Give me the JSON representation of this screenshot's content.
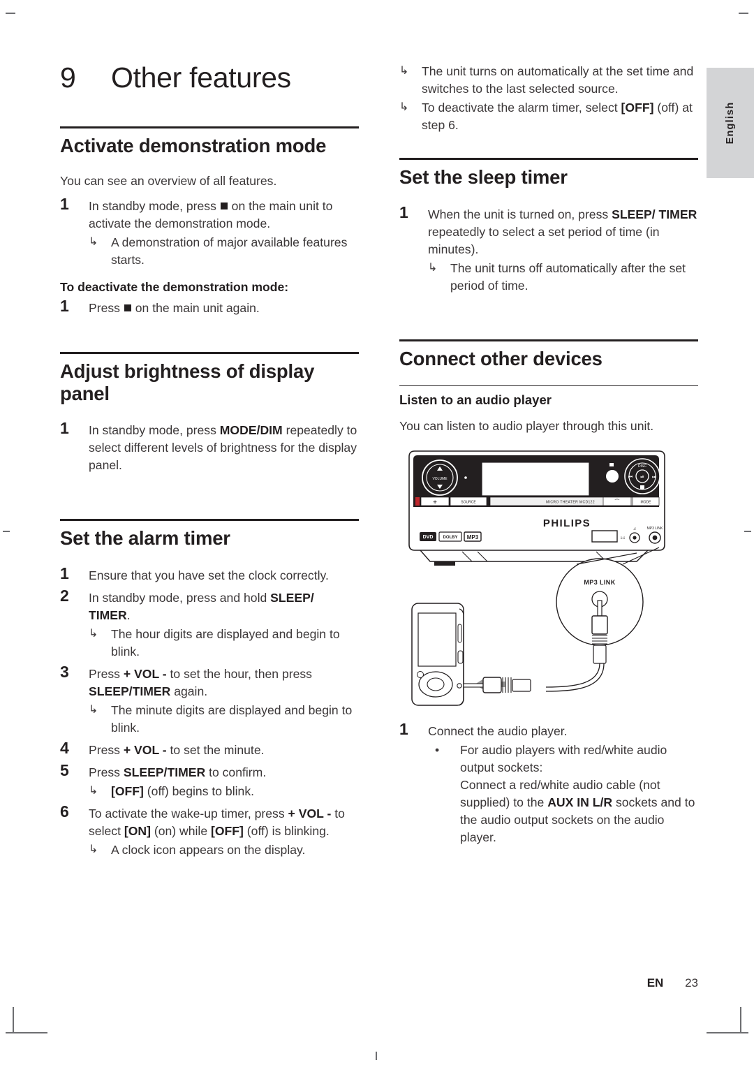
{
  "page": {
    "language_tab": "English",
    "footer_locale": "EN",
    "footer_page_number": "23"
  },
  "chapter": {
    "number": "9",
    "title": "Other features"
  },
  "sections": {
    "demo_mode": {
      "heading": "Activate demonstration mode",
      "intro": "You can see an overview of all features.",
      "step1_num": "1",
      "step1_a": "In standby mode, press ",
      "step1_b": " on the main unit to activate the demonstration mode.",
      "step1_result": "A demonstration of major available features starts.",
      "deactivate_label": "To deactivate the demonstration mode:",
      "deactivate_num": "1",
      "deactivate_a": "Press ",
      "deactivate_b": " on the main unit again."
    },
    "brightness": {
      "heading": "Adjust brightness of display panel",
      "step1_num": "1",
      "step1_a": "In standby mode, press ",
      "step1_key": "MODE/DIM",
      "step1_b": " repeatedly to select different levels of brightness for the display panel."
    },
    "alarm_timer": {
      "heading": "Set the alarm timer",
      "step1_num": "1",
      "step1": "Ensure that you have set the clock correctly.",
      "step2_num": "2",
      "step2_a": "In standby mode, press and hold ",
      "step2_key": "SLEEP/ TIMER",
      "step2_b": ".",
      "step2_result": "The hour digits are displayed and begin to blink.",
      "step3_num": "3",
      "step3_a": "Press ",
      "step3_key1": "+ VOL -",
      "step3_b": " to set the hour, then press ",
      "step3_key2": "SLEEP/TIMER",
      "step3_c": " again.",
      "step3_result": "The minute digits are displayed and begin to blink.",
      "step4_num": "4",
      "step4_a": "Press ",
      "step4_key": "+ VOL -",
      "step4_b": " to set the minute.",
      "step5_num": "5",
      "step5_a": "Press ",
      "step5_key": "SLEEP/TIMER",
      "step5_b": " to confirm.",
      "step5_result_key": "[OFF]",
      "step5_result_text": " (off) begins to blink.",
      "step6_num": "6",
      "step6_a": "To activate the wake-up timer, press ",
      "step6_key1": "+ VOL -",
      "step6_b": " to select ",
      "step6_key2": "[ON]",
      "step6_c": " (on) while ",
      "step6_key3": "[OFF]",
      "step6_d": " (off) is blinking.",
      "step6_result": "A clock icon appears on the display.",
      "result_a": "The unit turns on automatically at the set time and switches to the last selected source.",
      "result_b_a": "To deactivate the alarm timer, select ",
      "result_b_key": "[OFF]",
      "result_b_b": " (off) at step 6."
    },
    "sleep_timer": {
      "heading": "Set the sleep timer",
      "step1_num": "1",
      "step1_a": "When the unit is turned on, press ",
      "step1_key": "SLEEP/ TIMER",
      "step1_b": " repeatedly to select a set period of time (in minutes).",
      "step1_result": "The unit turns off automatically after the set period of time."
    },
    "connect_devices": {
      "heading": "Connect other devices",
      "subheading": "Listen to an audio player",
      "intro": "You can listen to audio player through this unit.",
      "step1_num": "1",
      "step1": "Connect the audio player.",
      "bullet1_a": "For audio players with red/white audio output sockets:",
      "bullet1_b": "Connect a red/white audio cable (not supplied) to the ",
      "bullet1_key": "AUX IN L/R",
      "bullet1_c": " sockets and to the audio output sockets on the audio player."
    }
  },
  "illustration": {
    "brand": "PHILIPS",
    "model_label": "MICRO THEATER MCD122",
    "volume_label": "VOLUME",
    "source_label": "SOURCE",
    "mode_label": "MODE",
    "disc_label": "DISC",
    "mp3_link_label": "MP3 LINK",
    "logo_dvd": "DVD",
    "logo_dolby": "DOLBY",
    "logo_mp3": "MP3",
    "standby_icon": "power-icon",
    "eject_icon": "eject-icon",
    "usb_icon": "usb-icon",
    "headphone_icon": "headphone-icon"
  }
}
